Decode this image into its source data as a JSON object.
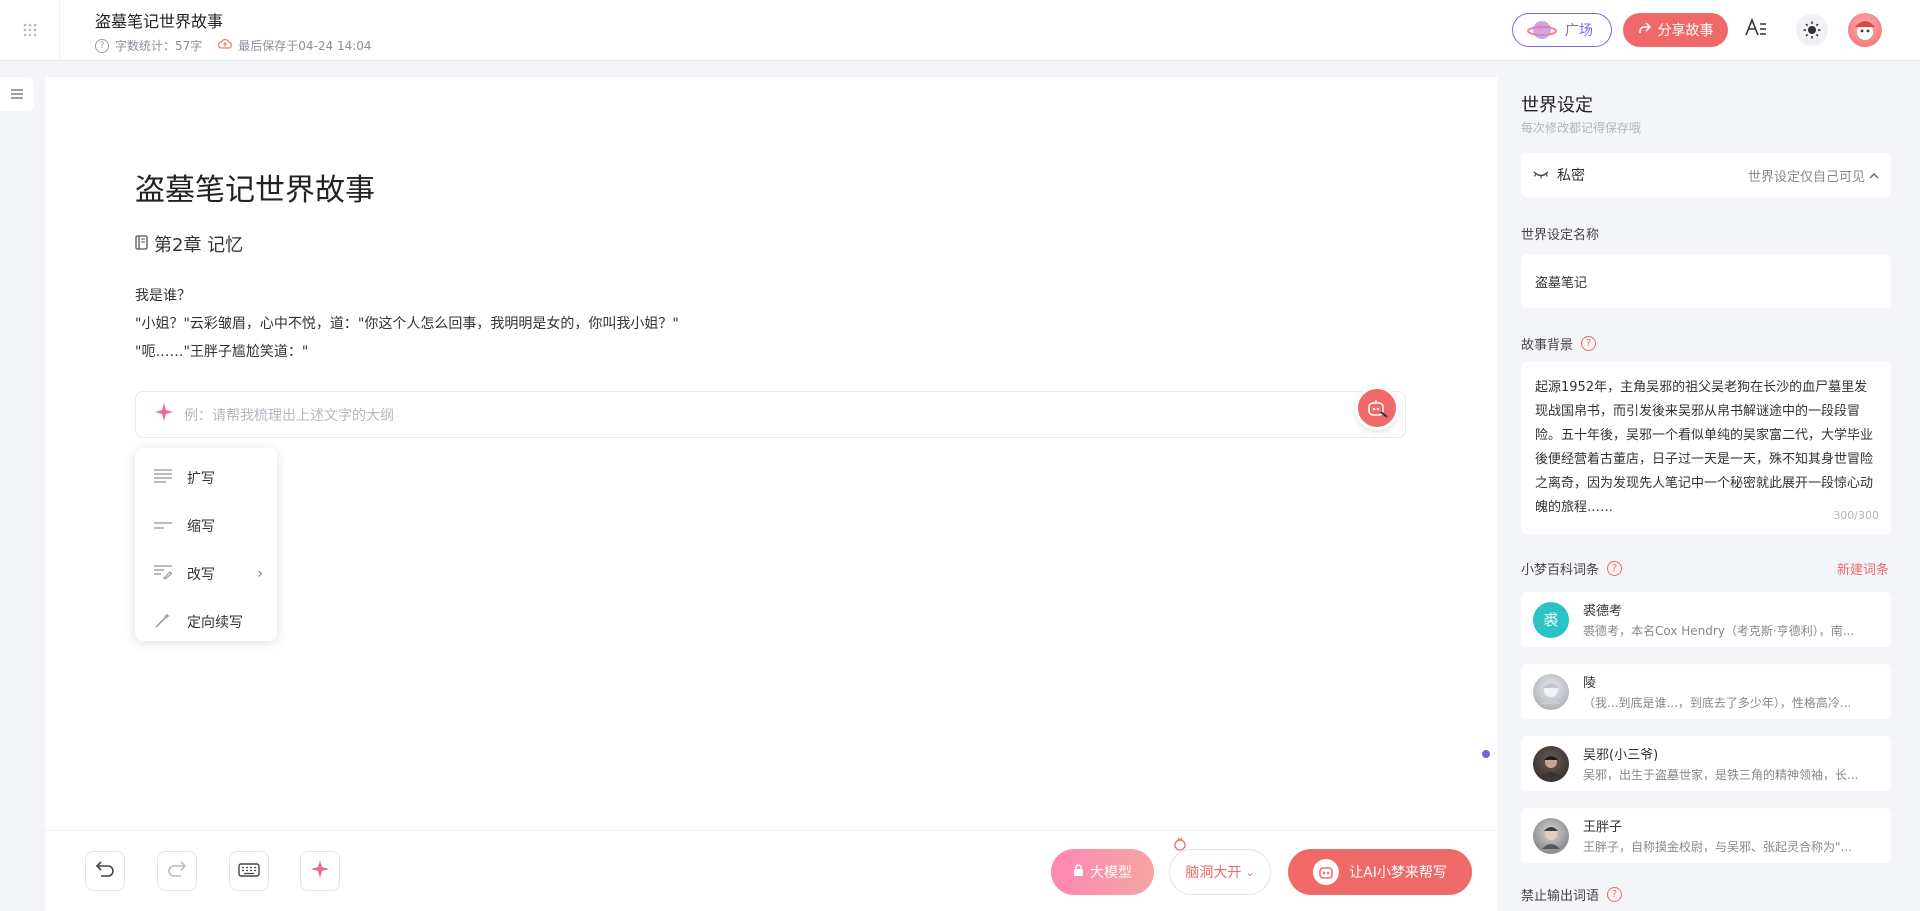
{
  "header": {
    "doc_title": "盗墓笔记世界故事",
    "word_count": "字数统计：57字",
    "last_saved": "最后保存于04-24 14:04",
    "plaza_label": "广场",
    "share_label": "分享故事"
  },
  "editor": {
    "story_title": "盗墓笔记世界故事",
    "chapter": "第2章 记忆",
    "paragraphs": [
      "我是谁？",
      "\"小姐？\"云彩皱眉，心中不悦，道：\"你这个人怎么回事，我明明是女的，你叫我小姐？\"",
      "\"呃……\"王胖子尴尬笑道：\""
    ],
    "ai_placeholder": "例：请帮我梳理出上述文字的大纲",
    "menu": [
      {
        "label": "扩写",
        "icon": "expand-lines-icon"
      },
      {
        "label": "缩写",
        "icon": "shorten-lines-icon"
      },
      {
        "label": "改写",
        "icon": "rewrite-icon"
      },
      {
        "label": "定向续写",
        "icon": "wand-icon"
      }
    ]
  },
  "bottom": {
    "model_label": "大模型",
    "brain_label": "脑洞大开",
    "help_label": "让AI小梦来帮写"
  },
  "panel": {
    "title": "世界设定",
    "subtitle": "每次修改都记得保存哦",
    "privacy_label": "私密",
    "privacy_note": "世界设定仅自己可见",
    "name_label": "世界设定名称",
    "name_value": "盗墓笔记",
    "background_label": "故事背景",
    "background_text": "起源1952年，主角吴邪的祖父吴老狗在长沙的血尸墓里发现战国帛书，而引发後来吴邪从帛书解谜途中的一段段冒险。五十年後，吴邪一个看似单纯的吴家富二代，大学毕业後便经营着古董店，日子过一天是一天，殊不知其身世冒险之离奇，因为发现先人笔记中一个秘密就此展开一段惊心动魄的旅程……",
    "counter": "300/300",
    "terms_label": "小梦百科词条",
    "new_term_label": "新建词条",
    "terms": [
      {
        "avatar_text": "裘",
        "name": "裘德考",
        "desc": "裘德考，本名Cox Hendry（考克斯·亨德利），南..."
      },
      {
        "avatar_text": "",
        "name": "陵",
        "desc": "（我...到底是谁...，到底去了多少年），性格高冷..."
      },
      {
        "avatar_text": "",
        "name": "吴邪(小三爷)",
        "desc": "吴邪，出生于盗墓世家，是铁三角的精神领袖，长..."
      },
      {
        "avatar_text": "",
        "name": "王胖子",
        "desc": "王胖子，自称摸金校尉，与吴邪、张起灵合称为\"..."
      }
    ],
    "forbidden_label": "禁止输出词语"
  },
  "colors": {
    "accent": "#ef6969",
    "purple": "#7b6be0",
    "teal": "#2ac3c6"
  }
}
